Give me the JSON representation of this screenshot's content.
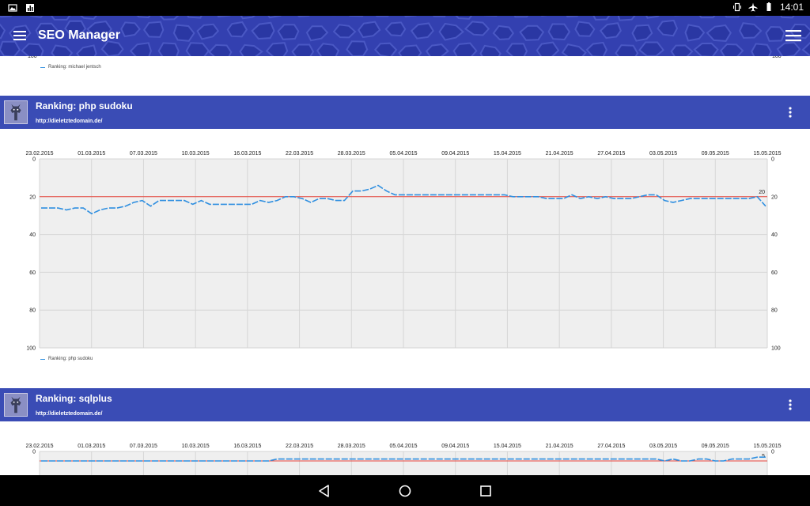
{
  "status_bar": {
    "time": "14:01"
  },
  "app_bar": {
    "title": "SEO Manager"
  },
  "colors": {
    "app_bar": "#3340b0",
    "card_header": "#3a4cb5",
    "series": "#2f8fe0",
    "threshold": "#e8463c",
    "plot_bg": "#efefef"
  },
  "top_card": {
    "legend": "Ranking: michael jentsch",
    "axis_left": "100",
    "axis_right": "100"
  },
  "cards": [
    {
      "title": "Ranking: php sudoku",
      "url": "http://dieletztedomain.de/",
      "legend": "Ranking: php sudoku"
    },
    {
      "title": "Ranking: sqlplus",
      "url": "http://dieletztedomain.de/"
    }
  ],
  "chart_data": [
    {
      "type": "line",
      "title": "",
      "xlabel": "",
      "ylabel": "",
      "x_tick_labels": [
        "23.02.2015",
        "01.03.2015",
        "07.03.2015",
        "10.03.2015",
        "16.03.2015",
        "22.03.2015",
        "28.03.2015",
        "05.04.2015",
        "09.04.2015",
        "15.04.2015",
        "21.04.2015",
        "27.04.2015",
        "03.05.2015",
        "09.05.2015",
        "15.05.2015"
      ],
      "y_tick_labels": [
        "0",
        "20",
        "40",
        "60",
        "80",
        "100"
      ],
      "ylim": [
        0,
        100
      ],
      "y_inverted": true,
      "grid": true,
      "threshold": {
        "value": 20,
        "label": "20"
      },
      "series": [
        {
          "name": "Ranking: php sudoku",
          "values": [
            26,
            26,
            26,
            27,
            26,
            26,
            29,
            27,
            26,
            26,
            25,
            23,
            22,
            25,
            22,
            22,
            22,
            22,
            24,
            22,
            24,
            24,
            24,
            24,
            24,
            24,
            22,
            23,
            22,
            20,
            20,
            21,
            23,
            21,
            21,
            22,
            22,
            17,
            17,
            16,
            14,
            17,
            19,
            19,
            19,
            19,
            19,
            19,
            19,
            19,
            19,
            19,
            19,
            19,
            19,
            19,
            20,
            20,
            20,
            20,
            21,
            21,
            21,
            19,
            21,
            20,
            21,
            20,
            21,
            21,
            21,
            20,
            19,
            19,
            22,
            23,
            22,
            21,
            21,
            21,
            21,
            21,
            21,
            21,
            21,
            20,
            25
          ]
        }
      ]
    },
    {
      "type": "line",
      "title": "",
      "xlabel": "",
      "ylabel": "",
      "x_tick_labels": [
        "23.02.2015",
        "01.03.2015",
        "07.03.2015",
        "10.03.2015",
        "16.03.2015",
        "22.03.2015",
        "28.03.2015",
        "05.04.2015",
        "09.04.2015",
        "15.04.2015",
        "21.04.2015",
        "27.04.2015",
        "03.05.2015",
        "09.05.2015",
        "15.05.2015"
      ],
      "y_tick_labels": [
        "0"
      ],
      "ylim": [
        0,
        100
      ],
      "y_inverted": true,
      "grid": true,
      "threshold": {
        "value": 5,
        "label": "5"
      },
      "series": [
        {
          "name": "Ranking: sqlplus",
          "values": [
            5,
            5,
            5,
            5,
            5,
            5,
            5,
            5,
            5,
            5,
            5,
            5,
            5,
            5,
            5,
            5,
            5,
            5,
            5,
            5,
            5,
            5,
            5,
            5,
            5,
            5,
            5,
            5,
            4,
            4,
            4,
            4,
            4,
            4,
            4,
            4,
            4,
            4,
            4,
            4,
            4,
            4,
            4,
            4,
            4,
            4,
            4,
            4,
            4,
            4,
            4,
            4,
            4,
            4,
            4,
            4,
            4,
            4,
            4,
            4,
            4,
            4,
            4,
            4,
            4,
            4,
            4,
            4,
            4,
            4,
            4,
            4,
            4,
            4,
            5,
            4,
            5,
            5,
            4,
            4,
            5,
            5,
            4,
            4,
            4,
            3,
            3
          ]
        }
      ]
    }
  ]
}
